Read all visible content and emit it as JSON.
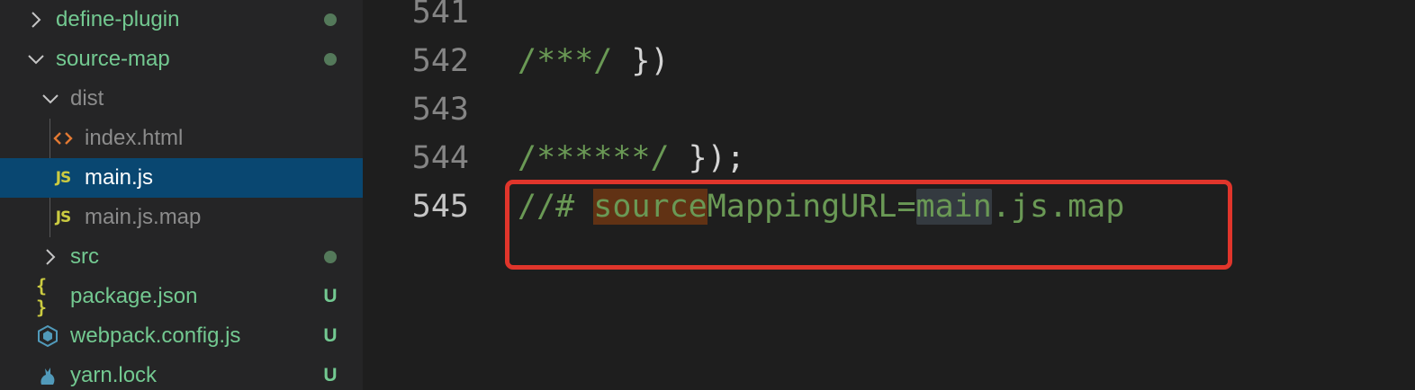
{
  "explorer": {
    "items": [
      {
        "label": "define-plugin",
        "type": "folder",
        "expanded": false,
        "status": "dot"
      },
      {
        "label": "source-map",
        "type": "folder",
        "expanded": true,
        "status": "dot"
      },
      {
        "label": "dist",
        "type": "folder",
        "expanded": true,
        "status": ""
      },
      {
        "label": "index.html",
        "type": "html-file",
        "status": ""
      },
      {
        "label": "main.js",
        "type": "js-file",
        "selected": true,
        "status": ""
      },
      {
        "label": "main.js.map",
        "type": "js-file",
        "status": ""
      },
      {
        "label": "src",
        "type": "folder",
        "expanded": false,
        "status": "dot"
      },
      {
        "label": "package.json",
        "type": "json-file",
        "status": "U"
      },
      {
        "label": "webpack.config.js",
        "type": "webpack-file",
        "status": "U"
      },
      {
        "label": "yarn.lock",
        "type": "yarn-file",
        "status": "U"
      }
    ],
    "js_badge": "JS",
    "json_badge": "{ }"
  },
  "editor": {
    "lines": [
      {
        "number": "541",
        "text": ""
      },
      {
        "number": "542",
        "text_comment": "/***/",
        "text_code": " })"
      },
      {
        "number": "543",
        "text": ""
      },
      {
        "number": "544",
        "text_comment": "/******/",
        "text_code": " });"
      },
      {
        "number": "545",
        "active": true,
        "seg1": "//# ",
        "seg2": "source",
        "seg3": "MappingURL=",
        "seg4": "main",
        "seg5": ".js.map"
      }
    ]
  },
  "colors": {
    "sidebar_bg": "#252526",
    "editor_bg": "#1e1e1e",
    "selection_bg": "#094771",
    "git_untracked": "#73c991",
    "comment": "#6a9955",
    "highlight_box": "#e0352b"
  }
}
